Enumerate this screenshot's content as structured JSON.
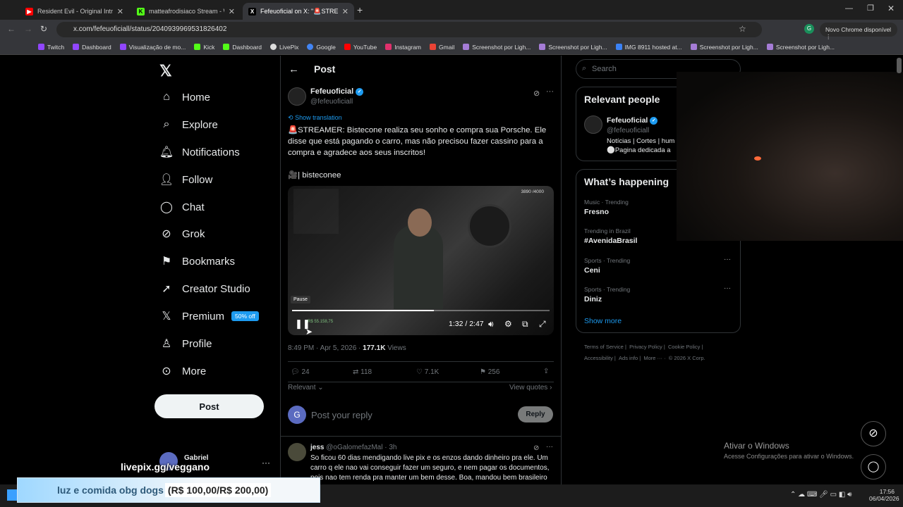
{
  "browser": {
    "tabs": [
      {
        "title": "Resident Evil - Original Intro 19",
        "color": "#ff0000"
      },
      {
        "title": "matteafrodisiaco Stream - Watc",
        "color": "#53fc18"
      },
      {
        "title": "Fefeuoficial on X: \"🚨STREA",
        "color": "#000000"
      }
    ],
    "url": "x.com/fefeuoficiall/status/2040939969531826402",
    "update_label": "Novo Chrome disponível",
    "profile_initial": "G",
    "bookmarks": [
      "Twitch",
      "Dashboard",
      "Visualização de mo...",
      "Kick",
      "Dashboard",
      "LivePix",
      "Google",
      "YouTube",
      "Instagram",
      "Gmail",
      "Screenshot por Ligh...",
      "Screenshot por Ligh...",
      "IMG 8911 hosted at...",
      "Screenshot por Ligh...",
      "Screenshot por Ligh..."
    ]
  },
  "nav": {
    "items": [
      "Home",
      "Explore",
      "Notifications",
      "Follow",
      "Chat",
      "Grok",
      "Bookmarks",
      "Creator Studio",
      "Premium",
      "Profile",
      "More"
    ],
    "premium_badge": "50% off",
    "post_button": "Post",
    "user_name": "Gabriel"
  },
  "post": {
    "header": "Post",
    "author_name": "Fefeuoficial",
    "author_handle": "@fefeuoficiall",
    "show_translation": "Show translation",
    "text": "🚨STREAMER: Bistecone realiza seu sonho e compra sua Porsche. Ele disse que está pagando o carro, mas não precisou fazer cassino para a compra e agradece aos seus inscritos!",
    "credit": "🎥| bisteconee",
    "video": {
      "overlay_count": "3890 /4000",
      "pause_tooltip": "Pause",
      "time": "1:32 / 2:47",
      "overlay_money": "R$ 55.158,75",
      "progress": 0.55
    },
    "timestamp": "8:49 PM · Apr 5, 2026 · ",
    "views_count": "177.1K",
    "views_label": " Views",
    "stats": {
      "replies": "24",
      "reposts": "118",
      "likes": "7.1K",
      "bookmarks": "256"
    },
    "relevant_label": "Relevant",
    "view_quotes": "View quotes",
    "reply_placeholder": "Post your reply",
    "reply_button": "Reply",
    "reply_avatar": "G"
  },
  "reply": {
    "name": "jess",
    "handle": "@oGalomefazMal · 3h",
    "text": "So ficou 60 dias mendigando live pix e os enzos dando dinheiro pra ele. Um carro q ele nao vai conseguir fazer um seguro, e nem pagar os documentos, pois nao tem renda pra manter um bem desse. Boa, mandou bem brasileiro"
  },
  "sidebar": {
    "search_placeholder": "Search",
    "relevant_title": "Relevant people",
    "person_name": "Fefeuoficial",
    "person_handle": "@fefeuoficiall",
    "person_bio_1": "Notícias | Cortes | hum",
    "person_bio_2": "⚪Pagina dedicada a",
    "happening_title": "What’s happening",
    "trends": [
      {
        "meta": "Music · Trending",
        "name": "Fresno"
      },
      {
        "meta": "Trending in Brazil",
        "name": "#AvenidaBrasil"
      },
      {
        "meta": "Sports · Trending",
        "name": "Ceni"
      },
      {
        "meta": "Sports · Trending",
        "name": "Diniz"
      }
    ],
    "show_more": "Show more",
    "footer_1": [
      "Terms of Service",
      "Privacy Policy",
      "Cookie Policy"
    ],
    "footer_2": [
      "Accessibility",
      "Ads info",
      "More ···",
      "© 2026 X Corp."
    ]
  },
  "overlays": {
    "livepix": "livepix.gg/veggano",
    "donation_text": "luz e comida obg dogs",
    "donation_amount": "(R$ 100,00/R$ 200,00)",
    "activate_title": "Ativar o Windows",
    "activate_sub": "Acesse Configurações para ativar o Windows."
  },
  "taskbar": {
    "time": "17:56",
    "date": "06/04/2026"
  }
}
